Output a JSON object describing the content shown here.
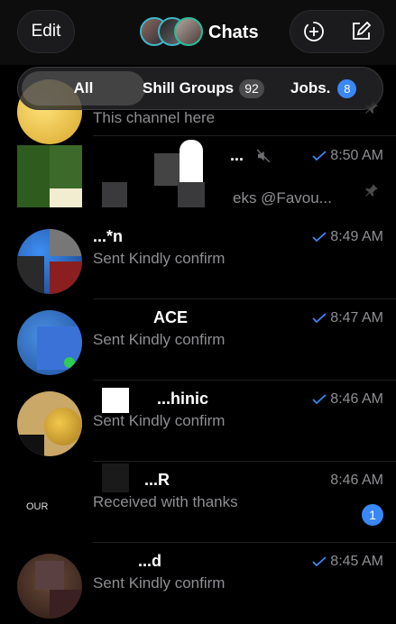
{
  "header": {
    "edit_label": "Edit",
    "title": "Chats"
  },
  "filters": [
    {
      "label": "All",
      "badge": ""
    },
    {
      "label": "Shill Groups",
      "badge": "92"
    },
    {
      "label": "Jobs.",
      "badge": "8"
    }
  ],
  "chats": [
    {
      "name": "",
      "preview": "This channel here",
      "time": "",
      "pinned": true
    },
    {
      "name": "...",
      "preview": "eks @Favou...",
      "time": "8:50 AM",
      "muted": true,
      "pinned": true,
      "read": true
    },
    {
      "name": "...*n",
      "preview": "Sent Kindly confirm",
      "time": "8:49 AM",
      "read": true
    },
    {
      "name": "ACE",
      "preview": "Sent Kindly confirm",
      "time": "8:47 AM",
      "read": true
    },
    {
      "name": "...hinic",
      "preview": "Sent Kindly confirm",
      "time": "8:46 AM",
      "read": true
    },
    {
      "name": "...R",
      "preview": "Received with thanks",
      "time": "8:46 AM",
      "unread": "1"
    },
    {
      "name": "...d",
      "preview": "Sent Kindly confirm",
      "time": "8:45 AM",
      "read": true
    }
  ],
  "colors": {
    "accent": "#3a87f6",
    "secondary_text": "#8e8e93",
    "background": "#000000"
  }
}
